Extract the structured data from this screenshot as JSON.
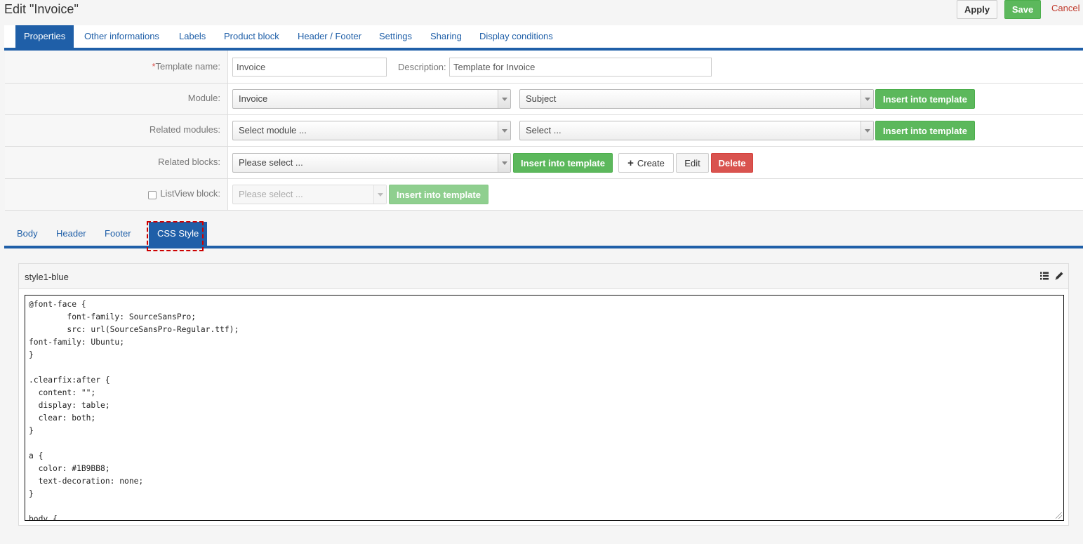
{
  "header": {
    "title": "Edit \"Invoice\"",
    "apply_label": "Apply",
    "save_label": "Save",
    "cancel_label": "Cancel"
  },
  "tabs_top": [
    {
      "label": "Properties",
      "active": true
    },
    {
      "label": "Other informations"
    },
    {
      "label": "Labels"
    },
    {
      "label": "Product block"
    },
    {
      "label": "Header / Footer"
    },
    {
      "label": "Settings"
    },
    {
      "label": "Sharing"
    },
    {
      "label": "Display conditions"
    }
  ],
  "form": {
    "template_name": {
      "required_mark": "*",
      "label": "Template name:",
      "value": "Invoice"
    },
    "description": {
      "label": "Description:",
      "value": "Template for Invoice"
    },
    "module": {
      "label": "Module:",
      "select1": "Invoice",
      "select2": "Subject",
      "insert_label": "Insert into template"
    },
    "related_modules": {
      "label": "Related modules:",
      "select1": "Select module ...",
      "select2": "Select ...",
      "insert_label": "Insert into template"
    },
    "related_blocks": {
      "label": "Related blocks:",
      "select": "Please select ...",
      "insert_label": "Insert into template",
      "create_label": "Create",
      "edit_label": "Edit",
      "delete_label": "Delete"
    },
    "listview_block": {
      "label": "ListView block:",
      "checked": false,
      "select": "Please select ...",
      "insert_label": "Insert into template"
    }
  },
  "tabs_bottom": [
    {
      "label": "Body"
    },
    {
      "label": "Header"
    },
    {
      "label": "Footer"
    },
    {
      "label": "CSS Style",
      "active": true
    }
  ],
  "editor": {
    "style_name": "style1-blue",
    "icons": [
      "list-icon",
      "pencil-icon"
    ],
    "code_lines": [
      "@font-face {",
      "        font-family: SourceSansPro;",
      "        src: url(SourceSansPro-Regular.ttf);",
      "font-family: Ubuntu;",
      "}",
      "",
      ".clearfix:after {",
      "  content: \"\";",
      "  display: table;",
      "  clear: both;",
      "}",
      "",
      "a {",
      "  color: #1B9BB8;",
      "  text-decoration: none;",
      "}",
      "",
      "body {"
    ]
  },
  "colors": {
    "primary": "#1f5fa8",
    "success": "#5cb85c",
    "danger": "#d9534f",
    "highlight": "#cc0000"
  }
}
